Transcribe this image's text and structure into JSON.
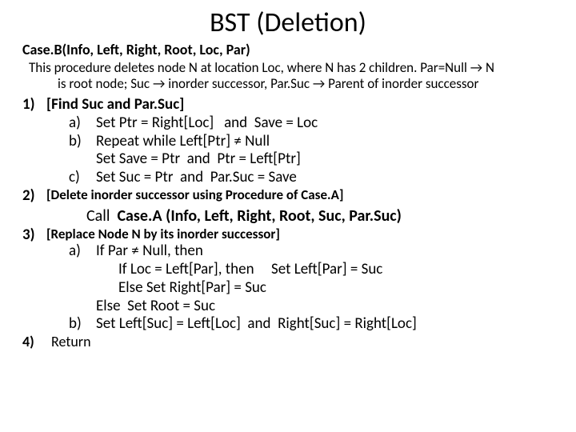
{
  "title": "BST (Deletion)",
  "signature": "Case.B(Info, Left, Right, Root, Loc, Par)",
  "description_line1": "This procedure deletes node N at location Loc, where N has 2 children. Par=Null → N",
  "description_line2": "is root node;  Suc → inorder successor,   Par.Suc → Parent of inorder successor",
  "s1": {
    "num": "1)",
    "head": "[Find Suc and Par.Suc]",
    "a": {
      "letter": "a)",
      "text": "Set Ptr = Right[Loc]   and  Save = Loc"
    },
    "b": {
      "letter": "b)",
      "text": "Repeat  while Left[Ptr] ≠ Null",
      "inner": "Set Save = Ptr  and  Ptr = Left[Ptr]"
    },
    "c": {
      "letter": "c)",
      "text": "Set Suc = Ptr  and  Par.Suc = Save"
    }
  },
  "s2": {
    "num": "2)",
    "head": "[Delete inorder successor using Procedure of  Case.A]",
    "call_prefix": "Call  ",
    "call": "Case.A (Info, Left, Right, Root, Suc, Par.Suc)"
  },
  "s3": {
    "num": "3)",
    "head": "[Replace Node N by its inorder successor]",
    "a": {
      "letter": "a)",
      "text": "If  Par ≠ Null, then",
      "l1": "If  Loc = Left[Par], then     Set Left[Par] = Suc",
      "l2": "Else  Set Right[Par]  = Suc",
      "l3": "Else  Set Root = Suc"
    },
    "b": {
      "letter": "b)",
      "text": "Set  Left[Suc] = Left[Loc]  and  Right[Suc] = Right[Loc]"
    }
  },
  "s4": {
    "num": "4)",
    "text": "Return"
  }
}
